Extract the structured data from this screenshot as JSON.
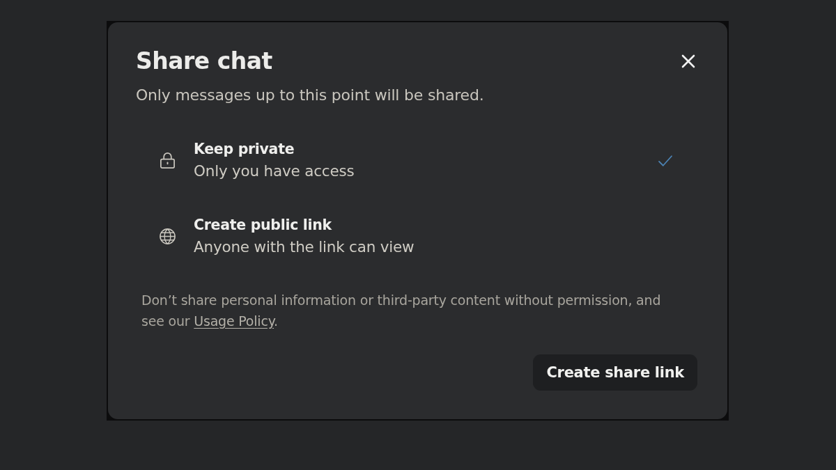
{
  "dialog": {
    "title": "Share chat",
    "subtitle": "Only messages up to this point will be shared.",
    "options": [
      {
        "kind": "private",
        "title": "Keep private",
        "description": "Only you have access",
        "selected": true
      },
      {
        "kind": "public",
        "title": "Create public link",
        "description": "Anyone with the link can view",
        "selected": false
      }
    ],
    "notice": {
      "text": "Don’t share personal information or third-party content without permission, and see our ",
      "link": "Usage Policy",
      "after": "."
    },
    "button": "Create share link"
  }
}
